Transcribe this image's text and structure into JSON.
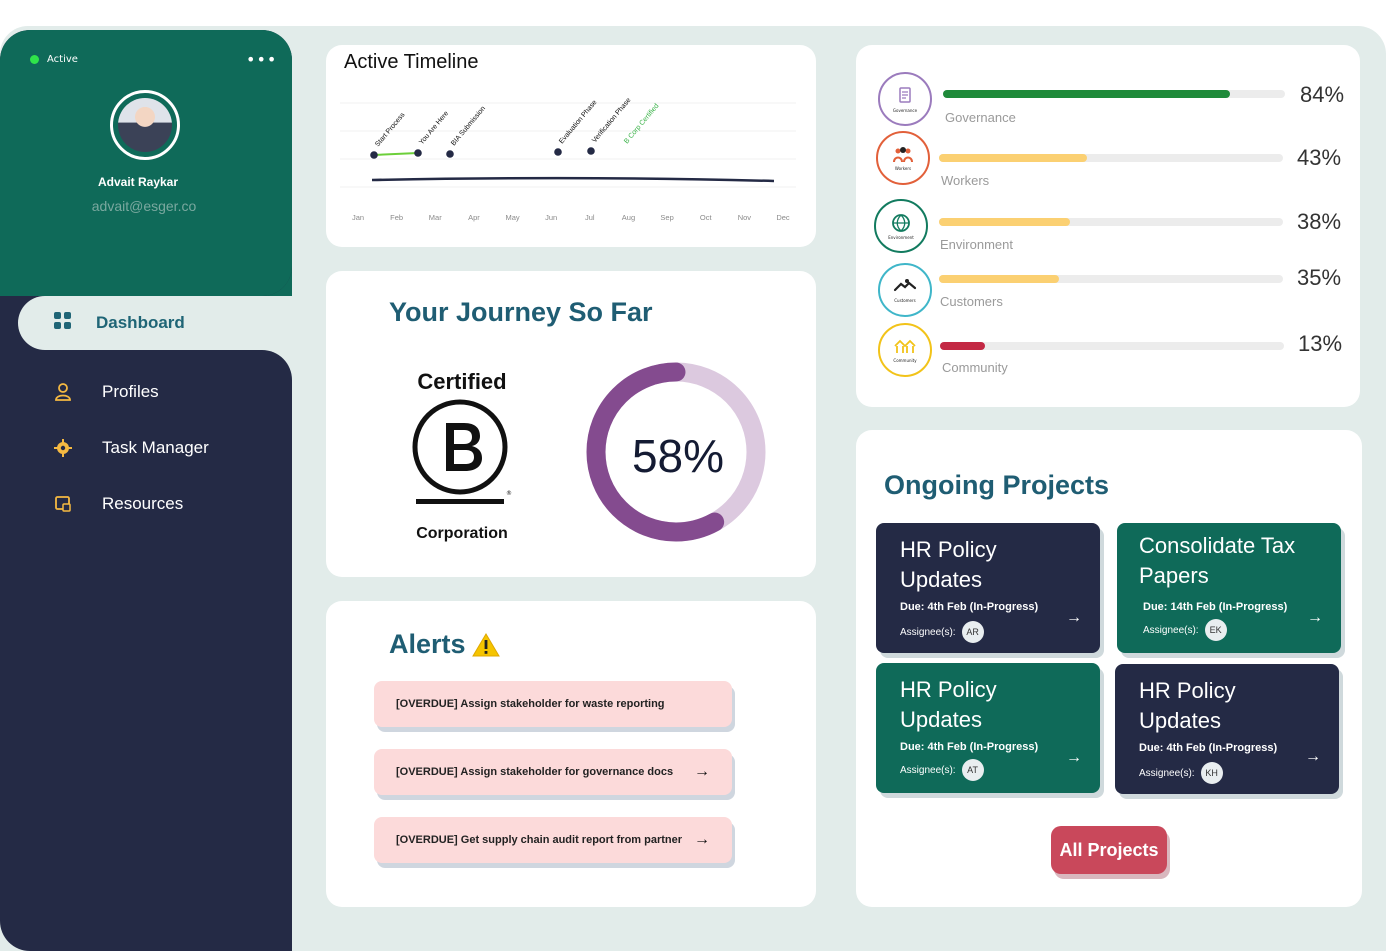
{
  "profile": {
    "status": "Active",
    "more": "•••",
    "name": "Advait Raykar",
    "email": "advait@esger.co"
  },
  "nav": {
    "active": "Dashboard",
    "items": [
      {
        "label": "Profiles",
        "icon": "user-icon"
      },
      {
        "label": "Task Manager",
        "icon": "gear-icon"
      },
      {
        "label": "Resources",
        "icon": "resources-icon"
      }
    ]
  },
  "timeline": {
    "title": "Active Timeline",
    "months": [
      "Jan",
      "Feb",
      "Mar",
      "Apr",
      "May",
      "Jun",
      "Jul",
      "Aug",
      "Sep",
      "Oct",
      "Nov",
      "Dec"
    ],
    "milestones": [
      "Start Process",
      "You Are Here",
      "BIA Submission",
      "Evaluation Phase",
      "Verification Phase",
      "B Corp Certified"
    ]
  },
  "journey": {
    "title": "Your Journey So Far",
    "logo_top": "Certified",
    "logo_bottom": "Corporation",
    "progress_label": "58%",
    "progress": 0.58
  },
  "alerts": {
    "title": "Alerts",
    "items": [
      "[OVERDUE] Assign stakeholder for waste reporting",
      "[OVERDUE] Assign stakeholder for governance docs",
      "[OVERDUE] Get supply chain audit report from partner"
    ]
  },
  "categories": [
    {
      "name": "Governance",
      "pct": "84%",
      "value": 0.84,
      "color": "#1f8a3a",
      "ring": "#9b7bbd",
      "mini": "Governance"
    },
    {
      "name": "Workers",
      "pct": "43%",
      "value": 0.43,
      "color": "#fbd072",
      "ring": "#e2603a",
      "mini": "Workers"
    },
    {
      "name": "Environment",
      "pct": "38%",
      "value": 0.38,
      "color": "#fbd072",
      "ring": "#127b5f",
      "mini": "Environment"
    },
    {
      "name": "Customers",
      "pct": "35%",
      "value": 0.35,
      "color": "#fbd072",
      "ring": "#3fb6c9",
      "mini": "Customers"
    },
    {
      "name": "Community",
      "pct": "13%",
      "value": 0.13,
      "color": "#c32844",
      "ring": "#f2c319",
      "mini": "Community"
    }
  ],
  "projects": {
    "title": "Ongoing Projects",
    "items": [
      {
        "title": "HR Policy Updates",
        "due": "Due: 4th Feb (In-Progress)",
        "assignee_label": "Assignee(s):",
        "assignee": "AR"
      },
      {
        "title": "Consolidate Tax Papers",
        "due": "Due: 14th Feb (In-Progress)",
        "assignee_label": "Assignee(s):",
        "assignee": "EK"
      },
      {
        "title": "HR Policy Updates",
        "due": "Due: 4th Feb (In-Progress)",
        "assignee_label": "Assignee(s):",
        "assignee": "AT"
      },
      {
        "title": "HR Policy Updates",
        "due": "Due: 4th Feb (In-Progress)",
        "assignee_label": "Assignee(s):",
        "assignee": "KH"
      }
    ],
    "all_button": "All Projects"
  },
  "colors": {
    "teal": "#0f6a59",
    "navy": "#242a45",
    "accent": "#c9485b",
    "heading": "#1f5d73",
    "donut": "#844b8f",
    "donut_track": "#dcc9df"
  }
}
